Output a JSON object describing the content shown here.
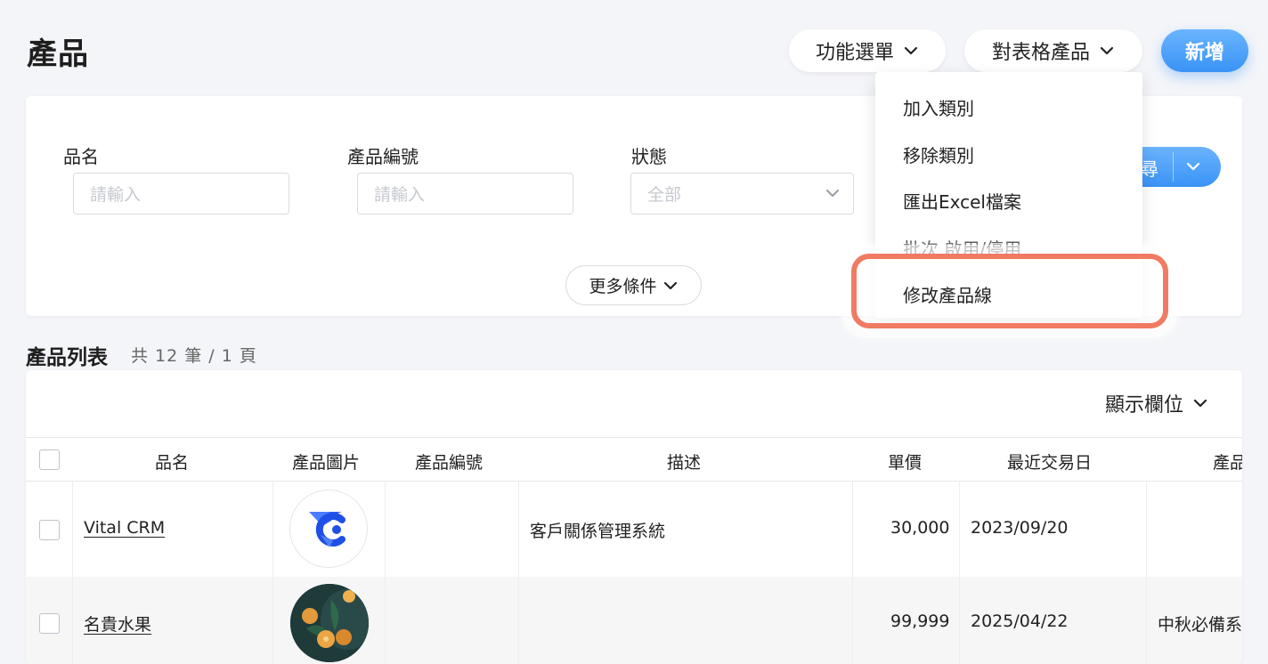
{
  "header": {
    "title": "產品",
    "function_menu_label": "功能選單",
    "table_products_label": "對表格產品",
    "new_label": "新增"
  },
  "filters": {
    "name_label": "品名",
    "name_placeholder": "請輸入",
    "code_label": "產品編號",
    "code_placeholder": "請輸入",
    "status_label": "狀態",
    "status_value": "全部",
    "more_label": "更多條件",
    "search_label_partial": "尋"
  },
  "list": {
    "title": "產品列表",
    "count_text": "共 12 筆 / 1 頁",
    "show_columns_label": "顯示欄位",
    "columns": [
      "品名",
      "產品圖片",
      "產品編號",
      "描述",
      "單價",
      "最近交易日",
      "產品"
    ],
    "rows": [
      {
        "name": "Vital CRM",
        "code": "",
        "description": "客戶關係管理系統",
        "price": "30,000",
        "last_date": "2023/09/20",
        "product_line": ""
      },
      {
        "name": "名貴水果",
        "code": "",
        "description": "",
        "price": "99,999",
        "last_date": "2025/04/22",
        "product_line": "中秋必備系"
      }
    ]
  },
  "dropdown": {
    "items": [
      "加入類別",
      "移除類別",
      "匯出Excel檔案",
      "批次 啟用/停用",
      "修改產品線"
    ]
  },
  "colors": {
    "accent": "#3a93f5",
    "highlight": "#f07a62"
  }
}
